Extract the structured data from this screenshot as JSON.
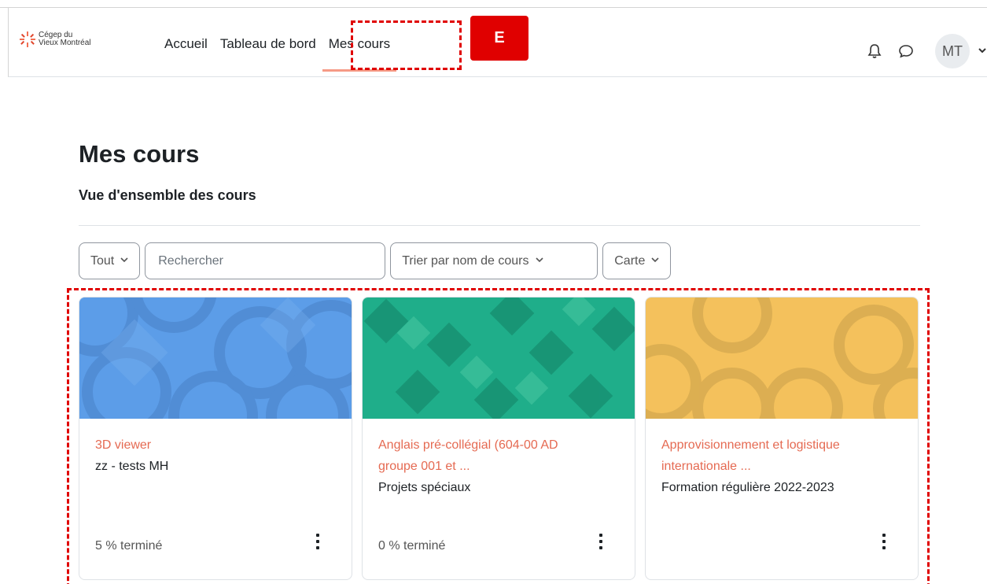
{
  "logo": {
    "line1": "Cégep du",
    "line2": "Vieux Montréal"
  },
  "nav": {
    "links": [
      "Accueil",
      "Tableau de bord",
      "Mes cours"
    ],
    "active_index": 2
  },
  "annotation": {
    "badge": "E",
    "color": "#e00000"
  },
  "user": {
    "initials": "MT"
  },
  "page": {
    "title": "Mes cours",
    "section": "Vue d'ensemble des cours"
  },
  "filters": {
    "grouping": "Tout",
    "search_placeholder": "Rechercher",
    "sort": "Trier par nom de cours",
    "view": "Carte"
  },
  "courses": [
    {
      "name": "3D viewer",
      "category": "zz - tests MH",
      "progress": "5 % terminé",
      "image_color": "#5b9be6",
      "pattern": "circles"
    },
    {
      "name": "Anglais pré-collégial (604-00 AD groupe 001 et ...",
      "name_line1": "Anglais pré-collégial (604-00 AD",
      "name_line2": "groupe 001 et ...",
      "category": "Projets spéciaux",
      "progress": "0 % terminé",
      "image_color": "#1fb08a",
      "pattern": "diamonds"
    },
    {
      "name": "Approvisionnement et logistique internationale ...",
      "name_line1": "Approvisionnement et logistique",
      "name_line2": "internationale ...",
      "category": "Formation régulière 2022-2023",
      "progress": "",
      "image_color": "#f3c05a",
      "pattern": "circles"
    }
  ],
  "colors": {
    "accent": "#f26f53",
    "course_link": "#e56a52"
  },
  "icons": [
    "bell-icon",
    "chat-icon",
    "chevron-down-icon",
    "kebab-menu-icon"
  ]
}
